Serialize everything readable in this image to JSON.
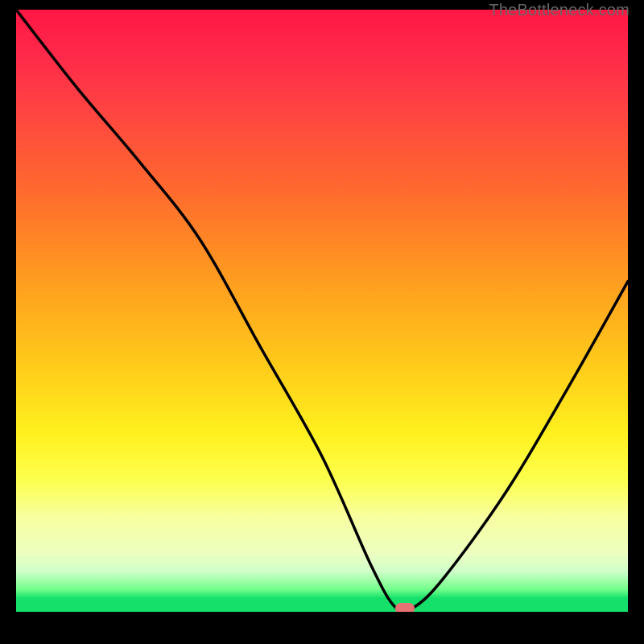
{
  "watermark": "TheBottleneck.com",
  "marker": {
    "color": "#e57373"
  },
  "chart_data": {
    "type": "line",
    "title": "",
    "xlabel": "",
    "ylabel": "",
    "xlim": [
      0,
      100
    ],
    "ylim": [
      0,
      100
    ],
    "grid": false,
    "legend": false,
    "series": [
      {
        "name": "bottleneck-curve",
        "x": [
          0,
          10,
          20,
          30,
          40,
          50,
          58,
          62,
          65,
          70,
          80,
          90,
          100
        ],
        "values": [
          100,
          87,
          75,
          62,
          44,
          26,
          8,
          1,
          1,
          6,
          20,
          37,
          55
        ]
      }
    ],
    "annotations": [
      {
        "name": "optimal-marker",
        "x": 63.5,
        "y": 0.8
      }
    ],
    "gradient_stops": [
      {
        "pos": 0,
        "color": "#ff1744"
      },
      {
        "pos": 0.5,
        "color": "#ffc81a"
      },
      {
        "pos": 0.78,
        "color": "#fdff4e"
      },
      {
        "pos": 0.97,
        "color": "#14e06a"
      },
      {
        "pos": 1.0,
        "color": "#14e06a"
      }
    ]
  }
}
